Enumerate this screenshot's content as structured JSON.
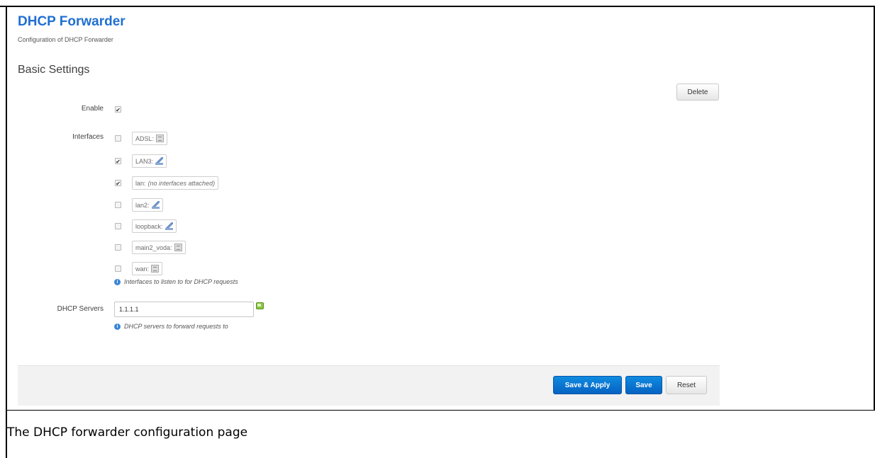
{
  "page": {
    "title": "DHCP Forwarder",
    "subtitle": "Configuration of DHCP Forwarder",
    "section_title": "Basic Settings",
    "delete_label": "Delete"
  },
  "enable": {
    "label": "Enable",
    "checked": true
  },
  "interfaces": {
    "label": "Interfaces",
    "items": [
      {
        "name": "ADSL:",
        "note": "",
        "icon": "ethernet-icon",
        "checked": false
      },
      {
        "name": "LAN3:",
        "note": "",
        "icon": "wireless-icon",
        "checked": true
      },
      {
        "name": "lan:",
        "note": "(no interfaces attached)",
        "icon": "",
        "checked": true
      },
      {
        "name": "lan2:",
        "note": "",
        "icon": "wireless-icon",
        "checked": false
      },
      {
        "name": "loopback:",
        "note": "",
        "icon": "wireless-icon",
        "checked": false
      },
      {
        "name": "main2_voda:",
        "note": "",
        "icon": "ethernet-icon",
        "checked": false
      },
      {
        "name": "wan:",
        "note": "",
        "icon": "ethernet-icon",
        "checked": false
      }
    ],
    "help": "Interfaces to listen to for DHCP requests"
  },
  "dhcp_servers": {
    "label": "DHCP Servers",
    "value": "1.1.1.1",
    "help": "DHCP servers to forward requests to"
  },
  "actions": {
    "save_apply": "Save & Apply",
    "save": "Save",
    "reset": "Reset"
  },
  "caption": "The DHCP forwarder configuration page",
  "colors": {
    "title": "#1f6fd1",
    "primary_button": "#0a75d4",
    "action_bar": "#f2f2f2"
  }
}
